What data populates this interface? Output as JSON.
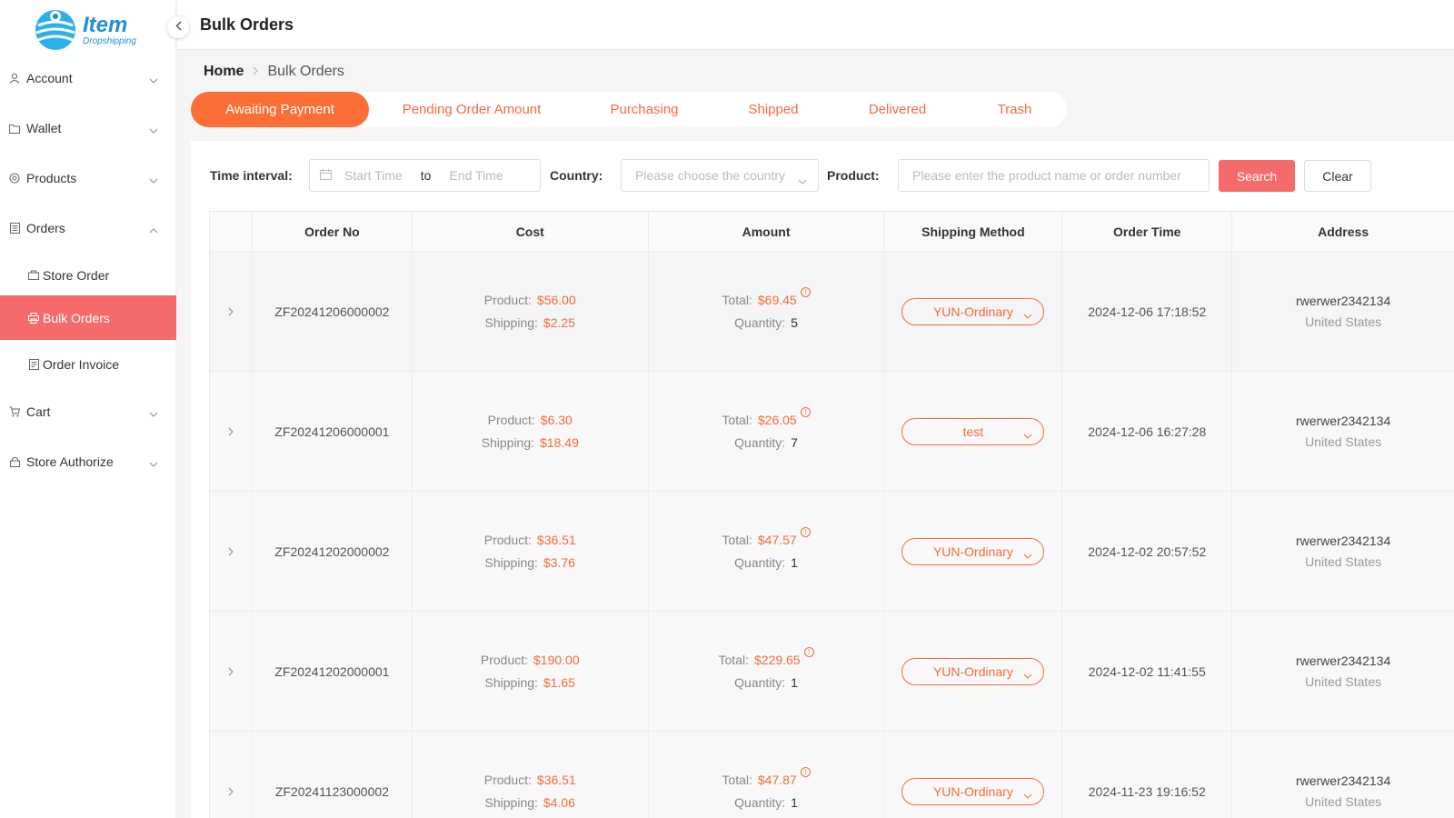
{
  "brand": {
    "name": "Item",
    "tagline": "Dropshipping",
    "color": "#1e8fd6"
  },
  "header": {
    "title": "Bulk Orders"
  },
  "sidebar": {
    "items": [
      {
        "label": "Account",
        "icon": "user-icon"
      },
      {
        "label": "Wallet",
        "icon": "folder-icon"
      },
      {
        "label": "Products",
        "icon": "globe-icon"
      },
      {
        "label": "Orders",
        "icon": "document-icon",
        "expanded": true
      },
      {
        "label": "Cart",
        "icon": "cart-icon"
      },
      {
        "label": "Store Authorize",
        "icon": "lock-icon"
      }
    ],
    "sub_items": [
      {
        "label": "Store Order",
        "icon": "store-icon"
      },
      {
        "label": "Bulk Orders",
        "icon": "printer-icon",
        "active": true
      },
      {
        "label": "Order Invoice",
        "icon": "invoice-icon"
      }
    ]
  },
  "breadcrumb": {
    "home": "Home",
    "current": "Bulk Orders"
  },
  "tabs": [
    {
      "label": "Awaiting Payment",
      "active": true
    },
    {
      "label": "Pending Order Amount"
    },
    {
      "label": "Purchasing"
    },
    {
      "label": "Shipped"
    },
    {
      "label": "Delivered"
    },
    {
      "label": "Trash"
    }
  ],
  "filters": {
    "time_label": "Time interval:",
    "start_placeholder": "Start Time",
    "to": "to",
    "end_placeholder": "End Time",
    "country_label": "Country:",
    "country_placeholder": "Please choose the country",
    "product_label": "Product:",
    "product_placeholder": "Please enter the product name or order number",
    "search_button": "Search",
    "clear_button": "Clear"
  },
  "table": {
    "columns": [
      "Order No",
      "Cost",
      "Amount",
      "Shipping Method",
      "Order Time",
      "Address"
    ],
    "labels": {
      "product": "Product:",
      "shipping": "Shipping:",
      "total": "Total:",
      "quantity": "Quantity:"
    },
    "rows": [
      {
        "order_no": "ZF20241206000002",
        "product_cost": "$56.00",
        "shipping_cost": "$2.25",
        "total": "$69.45",
        "quantity": "5",
        "shipping_method": "YUN-Ordinary",
        "order_time": "2024-12-06 17:18:52",
        "address_name": "rwerwer2342134",
        "address_country": "United States"
      },
      {
        "order_no": "ZF20241206000001",
        "product_cost": "$6.30",
        "shipping_cost": "$18.49",
        "total": "$26.05",
        "quantity": "7",
        "shipping_method": "test",
        "order_time": "2024-12-06 16:27:28",
        "address_name": "rwerwer2342134",
        "address_country": "United States"
      },
      {
        "order_no": "ZF20241202000002",
        "product_cost": "$36.51",
        "shipping_cost": "$3.76",
        "total": "$47.57",
        "quantity": "1",
        "shipping_method": "YUN-Ordinary",
        "order_time": "2024-12-02 20:57:52",
        "address_name": "rwerwer2342134",
        "address_country": "United States"
      },
      {
        "order_no": "ZF20241202000001",
        "product_cost": "$190.00",
        "shipping_cost": "$1.65",
        "total": "$229.65",
        "quantity": "1",
        "shipping_method": "YUN-Ordinary",
        "order_time": "2024-12-02 11:41:55",
        "address_name": "rwerwer2342134",
        "address_country": "United States"
      },
      {
        "order_no": "ZF20241123000002",
        "product_cost": "$36.51",
        "shipping_cost": "$4.06",
        "total": "$47.87",
        "quantity": "1",
        "shipping_method": "YUN-Ordinary",
        "order_time": "2024-11-23 19:16:52",
        "address_name": "rwerwer2342134",
        "address_country": "United States"
      }
    ]
  },
  "colors": {
    "accent": "#fb6e35",
    "active_nav": "#f56b6b",
    "price": "#f56b3c"
  }
}
